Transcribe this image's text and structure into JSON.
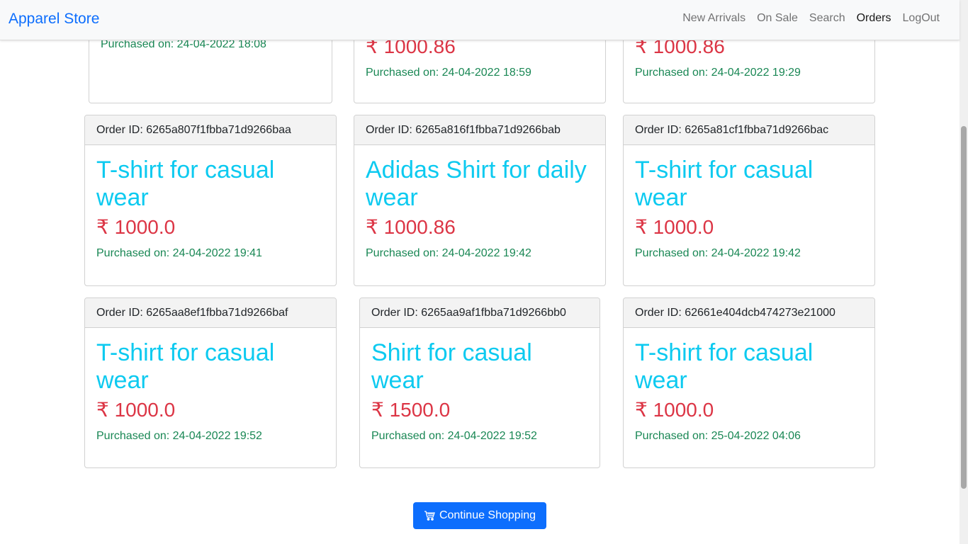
{
  "navbar": {
    "brand": "Apparel Store",
    "links": [
      {
        "label": "New Arrivals",
        "active": false
      },
      {
        "label": "On Sale",
        "active": false
      },
      {
        "label": "Search",
        "active": false
      },
      {
        "label": "Orders",
        "active": true
      },
      {
        "label": "LogOut",
        "active": false
      }
    ]
  },
  "partial_orders": [
    {
      "price": "",
      "purchased": "Purchased on: 24-04-2022 18:08"
    },
    {
      "price": "₹ 1000.86",
      "purchased": "Purchased on: 24-04-2022 18:59"
    },
    {
      "price": "₹ 1000.86",
      "purchased": "Purchased on: 24-04-2022 19:29"
    }
  ],
  "orders": [
    {
      "order_id": "Order ID: 6265a807f1fbba71d9266baa",
      "name": "T-shirt for casual wear",
      "price": "₹ 1000.0",
      "purchased": "Purchased on: 24-04-2022 19:41"
    },
    {
      "order_id": "Order ID: 6265a816f1fbba71d9266bab",
      "name": "Adidas Shirt for daily wear",
      "price": "₹ 1000.86",
      "purchased": "Purchased on: 24-04-2022 19:42"
    },
    {
      "order_id": "Order ID: 6265a81cf1fbba71d9266bac",
      "name": "T-shirt for casual wear",
      "price": "₹ 1000.0",
      "purchased": "Purchased on: 24-04-2022 19:42"
    },
    {
      "order_id": "Order ID: 6265aa8ef1fbba71d9266baf",
      "name": "T-shirt for casual wear",
      "price": "₹ 1000.0",
      "purchased": "Purchased on: 24-04-2022 19:52"
    },
    {
      "order_id": "Order ID: 6265aa9af1fbba71d9266bb0",
      "name": "Shirt for casual wear",
      "price": "₹ 1500.0",
      "purchased": "Purchased on: 24-04-2022 19:52"
    },
    {
      "order_id": "Order ID: 62661e404dcb474273e21000",
      "name": "T-shirt for casual wear",
      "price": "₹ 1000.0",
      "purchased": "Purchased on: 25-04-2022 04:06"
    }
  ],
  "cta": {
    "label": "Continue Shopping",
    "icon": "cart-icon"
  },
  "colors": {
    "brand": "#0d6efd",
    "product_name": "#0dcaf0",
    "price": "#dc3545",
    "purchased": "#198754"
  }
}
